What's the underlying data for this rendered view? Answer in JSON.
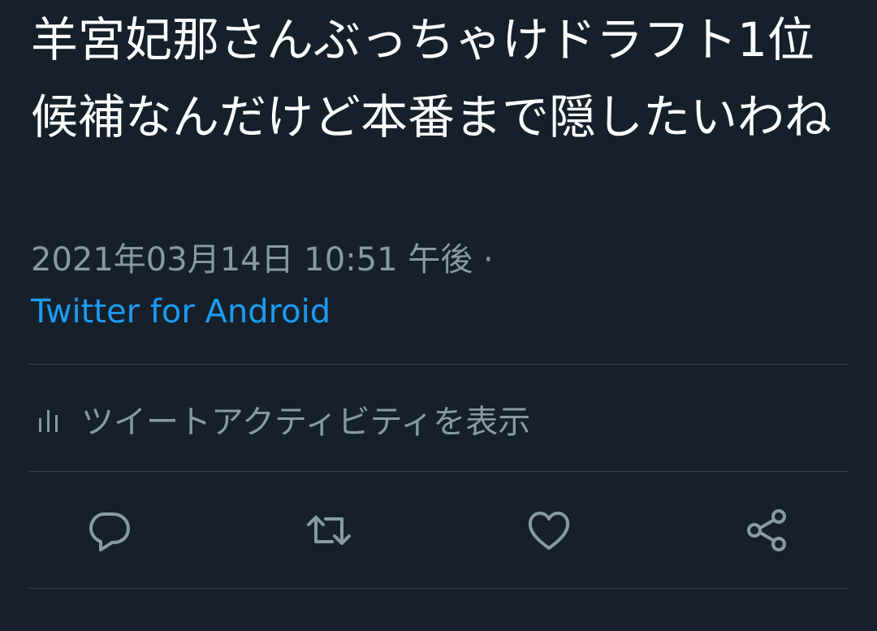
{
  "tweet": {
    "text": "羊宮妃那さんぶっちゃけドラフト1位候補なんだけど本番まで隠したいわね",
    "timestamp": "2021年03月14日 10:51 午後 ·",
    "source": "Twitter for Android"
  },
  "activity": {
    "label": "ツイートアクティビティを表示",
    "icon": "bar-chart-icon"
  },
  "actions": [
    {
      "name": "reply",
      "icon": "reply-icon"
    },
    {
      "name": "retweet",
      "icon": "retweet-icon"
    },
    {
      "name": "like",
      "icon": "like-icon"
    },
    {
      "name": "share",
      "icon": "share-icon"
    }
  ],
  "colors": {
    "background": "#15202b",
    "text": "#ffffff",
    "secondary": "#8899a6",
    "link": "#1d9bf0",
    "divider": "#38444d"
  }
}
